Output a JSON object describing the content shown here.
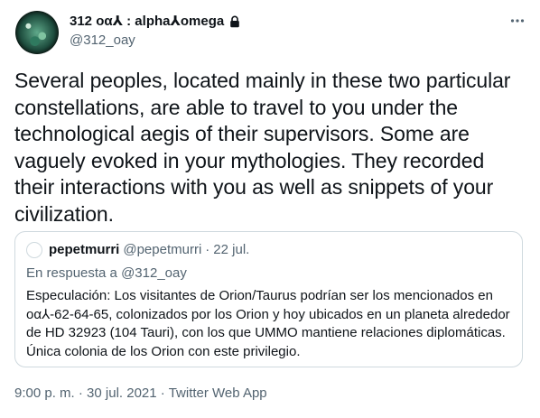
{
  "author": {
    "display_name": "312 οα⅄ : alpha⅄omega",
    "handle": "@312_oay",
    "protected_icon": "lock-icon",
    "avatar_icon": "green-planet-avatar"
  },
  "actions": {
    "more_icon": "more-horizontal-icon"
  },
  "tweet": {
    "text": "Several peoples, located mainly in these two particular constellations, are able to travel to you under the technological aegis of their supervisors. Some are vaguely evoked in your mythologies. They recorded their interactions with you as well as snippets of your civilization."
  },
  "quoted": {
    "name": "pepetmurri",
    "handle": "@pepetmurri",
    "separator": "·",
    "date": "22 jul.",
    "reply_prefix": "En respuesta a",
    "reply_to": "@312_oay",
    "text": "Especulación: Los visitantes de Orion/Taurus podrían ser los mencionados en οα⅄-62-64-65, colonizados por los Orion y hoy ubicados en un planeta alrededor de HD 32923 (104 Tauri), con los que UMMO mantiene relaciones diplomáticas. Única colonia de los Orion con este privilegio."
  },
  "meta": {
    "time": "9:00 p. m.",
    "separator": "·",
    "date": "30 jul. 2021",
    "client": "Twitter Web App"
  },
  "colors": {
    "text_primary": "#0f1419",
    "text_secondary": "#536471",
    "border": "#cfd9de"
  }
}
